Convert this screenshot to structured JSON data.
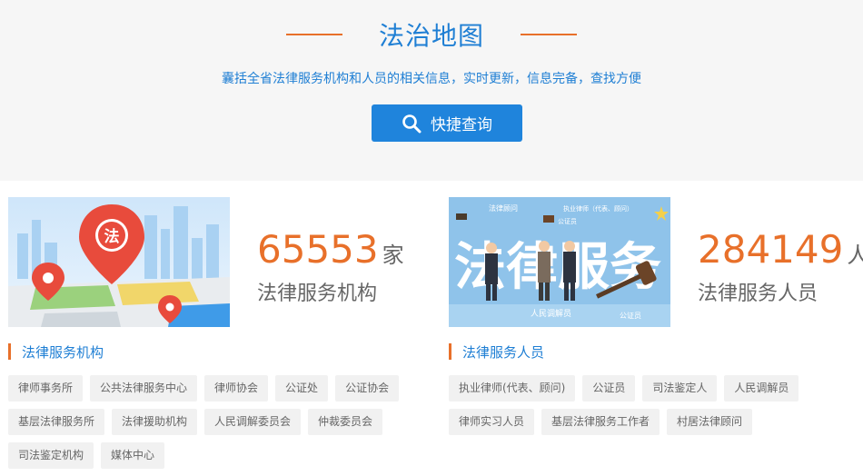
{
  "hero": {
    "title": "法治地图",
    "subtitle": "囊括全省法律服务机构和人员的相关信息，实时更新，信息完备，查找方便",
    "quick_search_label": "快捷查询"
  },
  "institutions": {
    "count": "65553",
    "unit": "家",
    "label": "法律服务机构",
    "badge_char": "法",
    "section_title": "法律服务机构",
    "tags": [
      "律师事务所",
      "公共法律服务中心",
      "律师协会",
      "公证处",
      "公证协会",
      "基层法律服务所",
      "法律援助机构",
      "人民调解委员会",
      "仲裁委员会",
      "司法鉴定机构",
      "媒体中心"
    ]
  },
  "personnel": {
    "count": "284149",
    "unit": "人",
    "label": "法律服务人员",
    "image_text": "法律服务",
    "image_words": [
      "法律顾问",
      "执业律师（代表、顾问）",
      "公证员",
      "人民调解员",
      "公证员"
    ],
    "section_title": "法律服务人员",
    "tags": [
      "执业律师(代表、顾问)",
      "公证员",
      "司法鉴定人",
      "人民调解员",
      "律师实习人员",
      "基层法律服务工作者",
      "村居法律顾问"
    ]
  },
  "colors": {
    "accent_orange": "#e8702a",
    "primary_blue": "#1f7fd4",
    "button_blue": "#1f84dc"
  },
  "icons": {
    "search": "search-icon",
    "map_pin": "map-pin-icon"
  }
}
